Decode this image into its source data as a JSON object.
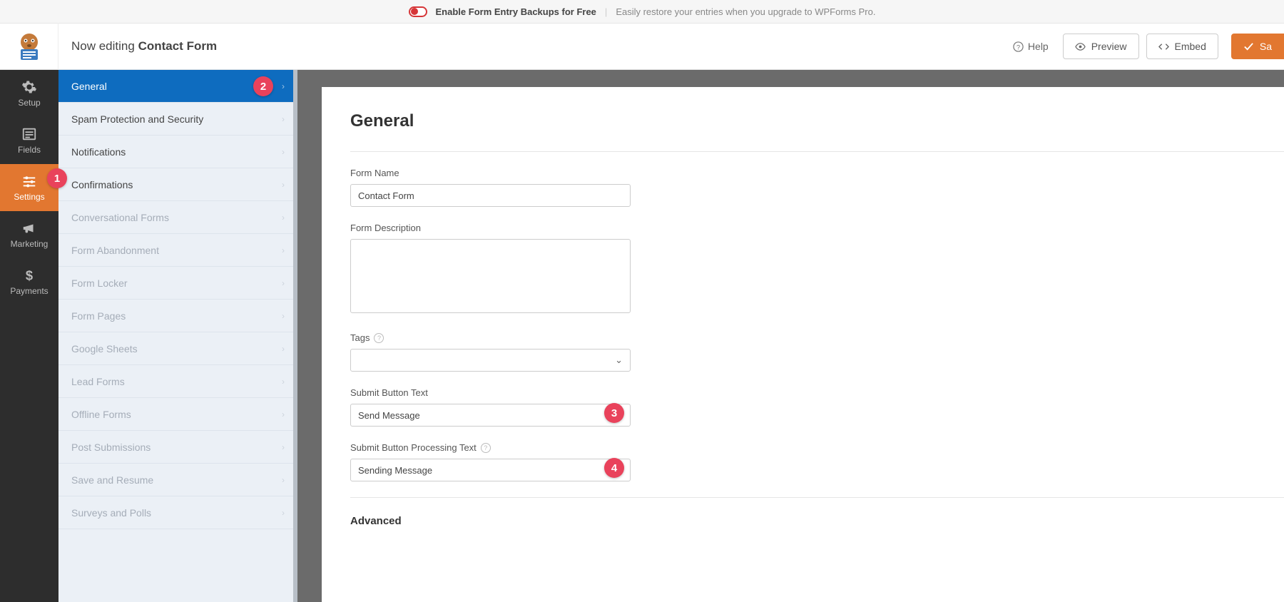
{
  "promo": {
    "bold": "Enable Form Entry Backups for Free",
    "sub": "Easily restore your entries when you upgrade to WPForms Pro."
  },
  "header": {
    "prefix": "Now editing ",
    "form_name": "Contact Form",
    "help": "Help",
    "preview": "Preview",
    "embed": "Embed",
    "save": "Sa"
  },
  "leftnav": {
    "setup": "Setup",
    "fields": "Fields",
    "settings": "Settings",
    "marketing": "Marketing",
    "payments": "Payments"
  },
  "subnav": {
    "general": "General",
    "spam": "Spam Protection and Security",
    "notifications": "Notifications",
    "confirmations": "Confirmations",
    "conversational": "Conversational Forms",
    "abandonment": "Form Abandonment",
    "locker": "Form Locker",
    "pages": "Form Pages",
    "sheets": "Google Sheets",
    "lead": "Lead Forms",
    "offline": "Offline Forms",
    "post": "Post Submissions",
    "save_resume": "Save and Resume",
    "surveys": "Surveys and Polls"
  },
  "badges": {
    "b1": "1",
    "b2": "2",
    "b3": "3",
    "b4": "4"
  },
  "form": {
    "title": "General",
    "name_label": "Form Name",
    "name_value": "Contact Form",
    "desc_label": "Form Description",
    "tags_label": "Tags",
    "submit_label": "Submit Button Text",
    "submit_value": "Send Message",
    "processing_label": "Submit Button Processing Text",
    "processing_value": "Sending Message",
    "advanced": "Advanced"
  }
}
